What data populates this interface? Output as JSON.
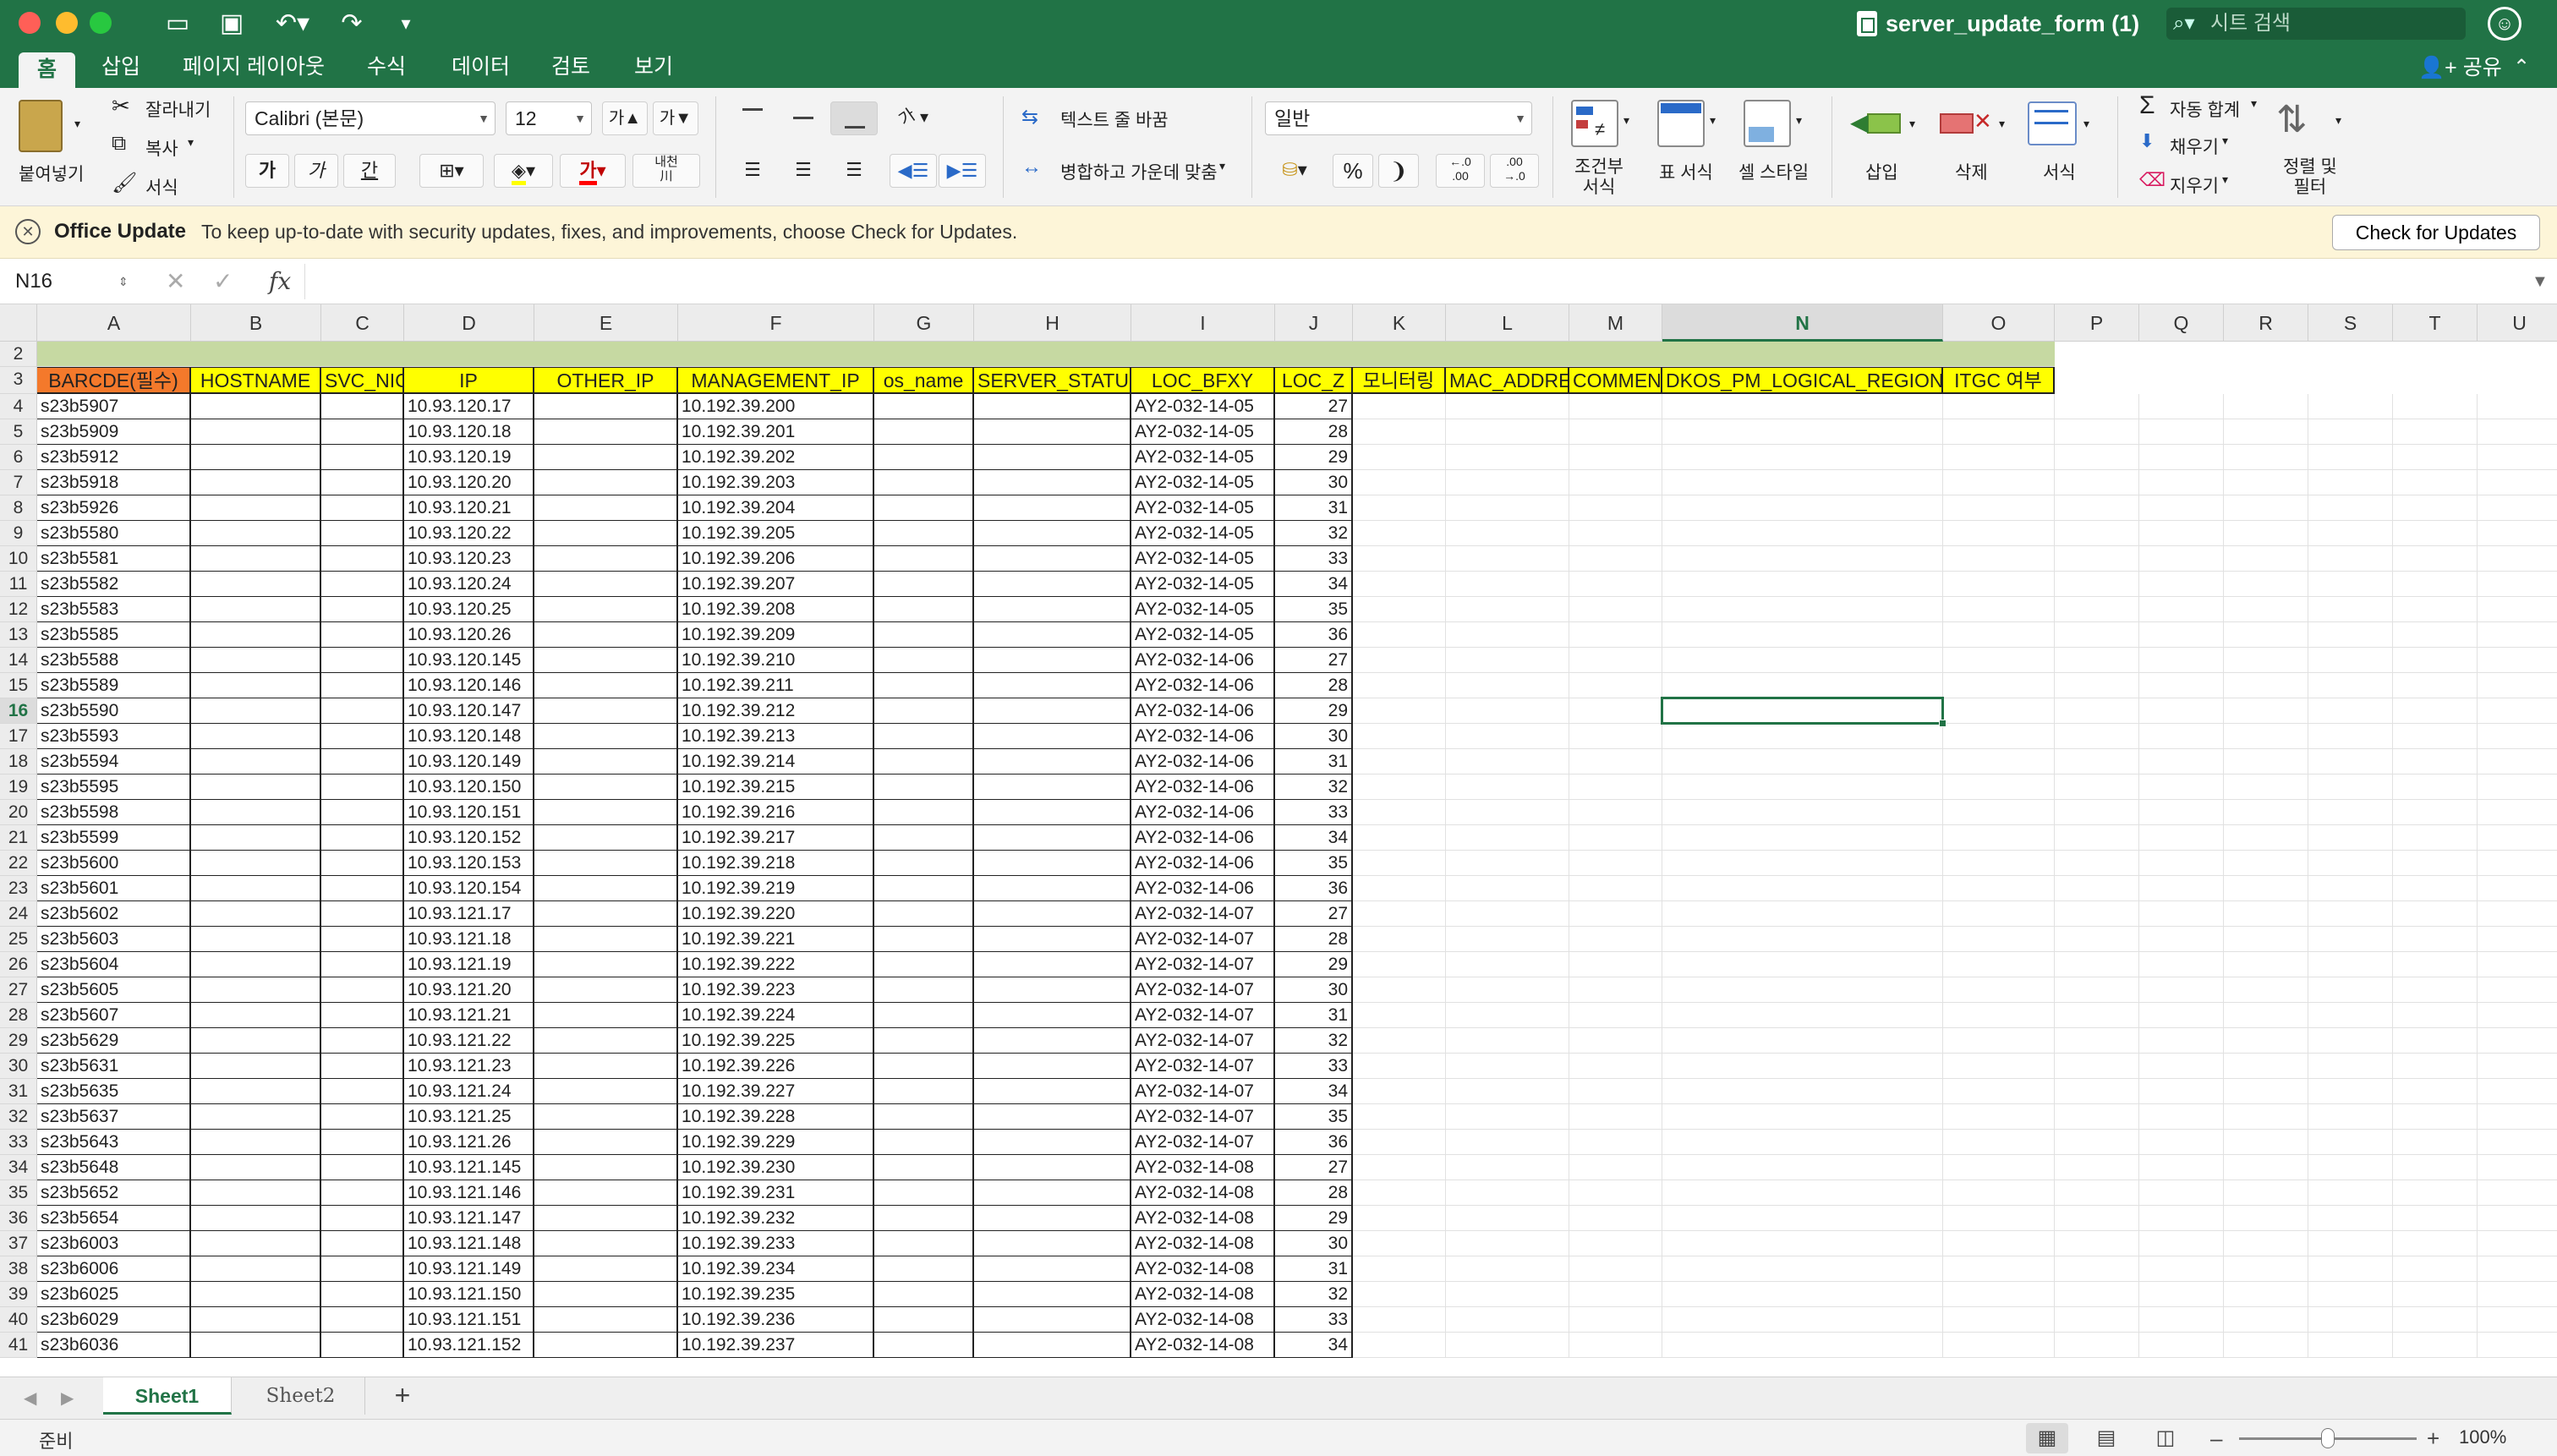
{
  "window": {
    "title": "server_update_form (1)"
  },
  "search": {
    "placeholder": "시트 검색",
    "icon": "search-icon"
  },
  "ribbon_tabs": [
    "홈",
    "삽입",
    "페이지 레이아웃",
    "수식",
    "데이터",
    "검토",
    "보기"
  ],
  "share_label": "공유",
  "ribbon": {
    "clipboard": {
      "paste": "붙여넣기",
      "cut": "잘라내기",
      "copy": "복사",
      "format_painter": "서식"
    },
    "font": {
      "name": "Calibri (본문)",
      "size": "12",
      "grow": "가▲",
      "shrink": "가▼",
      "bold": "가",
      "italic": "가",
      "underline": "간",
      "color_glyph": "가",
      "phonetic": "내천\n川"
    },
    "alignment": {
      "wrap_text": "텍스트 줄 바꿈",
      "merge_center": "병합하고 가운데 맞춤",
      "orientation": "가"
    },
    "number": {
      "format": "일반",
      "percent": "%",
      "comma": "❩",
      "inc_decimal": "←.0\n.00",
      "dec_decimal": ".00\n→.0"
    },
    "styles": {
      "conditional": "조건부\n서식",
      "table": "표 서식",
      "cell_style": "셀 스타일"
    },
    "cells": {
      "insert": "삽입",
      "delete": "삭제",
      "format": "서식"
    },
    "editing": {
      "autosum": "자동 합계",
      "fill": "채우기",
      "clear": "지우기",
      "sort_filter": "정렬 및\n필터"
    }
  },
  "update_bar": {
    "title": "Office Update",
    "message": "To keep up-to-date with security updates, fixes, and improvements, choose Check for Updates.",
    "button": "Check for Updates"
  },
  "formula_bar": {
    "name_box": "N16",
    "cancel": "✕",
    "enter": "✓",
    "fx": "fx",
    "value": ""
  },
  "grid": {
    "columns": [
      "A",
      "B",
      "C",
      "D",
      "E",
      "F",
      "G",
      "H",
      "I",
      "J",
      "K",
      "L",
      "M",
      "N",
      "O",
      "P",
      "Q",
      "R",
      "S",
      "T",
      "U"
    ],
    "selected_column": "N",
    "selected_cell": "N16",
    "header_row": [
      "BARCDE(필수)",
      "HOSTNAME",
      "SVC_NICK",
      "IP",
      "OTHER_IP",
      "MANAGEMENT_IP",
      "os_name",
      "SERVER_STATUS",
      "LOC_BFXY",
      "LOC_Z",
      "모니터링",
      "MAC_ADDRESS",
      "COMMENT",
      "DKOS_PM_LOGICAL_REGION",
      "ITGC 여부"
    ],
    "rows": [
      {
        "n": "4",
        "a": "s23b5907",
        "d": "10.93.120.17",
        "f": "10.192.39.200",
        "i": "AY2-032-14-05",
        "j": "27"
      },
      {
        "n": "5",
        "a": "s23b5909",
        "d": "10.93.120.18",
        "f": "10.192.39.201",
        "i": "AY2-032-14-05",
        "j": "28"
      },
      {
        "n": "6",
        "a": "s23b5912",
        "d": "10.93.120.19",
        "f": "10.192.39.202",
        "i": "AY2-032-14-05",
        "j": "29"
      },
      {
        "n": "7",
        "a": "s23b5918",
        "d": "10.93.120.20",
        "f": "10.192.39.203",
        "i": "AY2-032-14-05",
        "j": "30"
      },
      {
        "n": "8",
        "a": "s23b5926",
        "d": "10.93.120.21",
        "f": "10.192.39.204",
        "i": "AY2-032-14-05",
        "j": "31"
      },
      {
        "n": "9",
        "a": "s23b5580",
        "d": "10.93.120.22",
        "f": "10.192.39.205",
        "i": "AY2-032-14-05",
        "j": "32"
      },
      {
        "n": "10",
        "a": "s23b5581",
        "d": "10.93.120.23",
        "f": "10.192.39.206",
        "i": "AY2-032-14-05",
        "j": "33"
      },
      {
        "n": "11",
        "a": "s23b5582",
        "d": "10.93.120.24",
        "f": "10.192.39.207",
        "i": "AY2-032-14-05",
        "j": "34"
      },
      {
        "n": "12",
        "a": "s23b5583",
        "d": "10.93.120.25",
        "f": "10.192.39.208",
        "i": "AY2-032-14-05",
        "j": "35"
      },
      {
        "n": "13",
        "a": "s23b5585",
        "d": "10.93.120.26",
        "f": "10.192.39.209",
        "i": "AY2-032-14-05",
        "j": "36"
      },
      {
        "n": "14",
        "a": "s23b5588",
        "d": "10.93.120.145",
        "f": "10.192.39.210",
        "i": "AY2-032-14-06",
        "j": "27"
      },
      {
        "n": "15",
        "a": "s23b5589",
        "d": "10.93.120.146",
        "f": "10.192.39.211",
        "i": "AY2-032-14-06",
        "j": "28"
      },
      {
        "n": "16",
        "a": "s23b5590",
        "d": "10.93.120.147",
        "f": "10.192.39.212",
        "i": "AY2-032-14-06",
        "j": "29"
      },
      {
        "n": "17",
        "a": "s23b5593",
        "d": "10.93.120.148",
        "f": "10.192.39.213",
        "i": "AY2-032-14-06",
        "j": "30"
      },
      {
        "n": "18",
        "a": "s23b5594",
        "d": "10.93.120.149",
        "f": "10.192.39.214",
        "i": "AY2-032-14-06",
        "j": "31"
      },
      {
        "n": "19",
        "a": "s23b5595",
        "d": "10.93.120.150",
        "f": "10.192.39.215",
        "i": "AY2-032-14-06",
        "j": "32"
      },
      {
        "n": "20",
        "a": "s23b5598",
        "d": "10.93.120.151",
        "f": "10.192.39.216",
        "i": "AY2-032-14-06",
        "j": "33"
      },
      {
        "n": "21",
        "a": "s23b5599",
        "d": "10.93.120.152",
        "f": "10.192.39.217",
        "i": "AY2-032-14-06",
        "j": "34"
      },
      {
        "n": "22",
        "a": "s23b5600",
        "d": "10.93.120.153",
        "f": "10.192.39.218",
        "i": "AY2-032-14-06",
        "j": "35"
      },
      {
        "n": "23",
        "a": "s23b5601",
        "d": "10.93.120.154",
        "f": "10.192.39.219",
        "i": "AY2-032-14-06",
        "j": "36"
      },
      {
        "n": "24",
        "a": "s23b5602",
        "d": "10.93.121.17",
        "f": "10.192.39.220",
        "i": "AY2-032-14-07",
        "j": "27"
      },
      {
        "n": "25",
        "a": "s23b5603",
        "d": "10.93.121.18",
        "f": "10.192.39.221",
        "i": "AY2-032-14-07",
        "j": "28"
      },
      {
        "n": "26",
        "a": "s23b5604",
        "d": "10.93.121.19",
        "f": "10.192.39.222",
        "i": "AY2-032-14-07",
        "j": "29"
      },
      {
        "n": "27",
        "a": "s23b5605",
        "d": "10.93.121.20",
        "f": "10.192.39.223",
        "i": "AY2-032-14-07",
        "j": "30"
      },
      {
        "n": "28",
        "a": "s23b5607",
        "d": "10.93.121.21",
        "f": "10.192.39.224",
        "i": "AY2-032-14-07",
        "j": "31"
      },
      {
        "n": "29",
        "a": "s23b5629",
        "d": "10.93.121.22",
        "f": "10.192.39.225",
        "i": "AY2-032-14-07",
        "j": "32"
      },
      {
        "n": "30",
        "a": "s23b5631",
        "d": "10.93.121.23",
        "f": "10.192.39.226",
        "i": "AY2-032-14-07",
        "j": "33"
      },
      {
        "n": "31",
        "a": "s23b5635",
        "d": "10.93.121.24",
        "f": "10.192.39.227",
        "i": "AY2-032-14-07",
        "j": "34"
      },
      {
        "n": "32",
        "a": "s23b5637",
        "d": "10.93.121.25",
        "f": "10.192.39.228",
        "i": "AY2-032-14-07",
        "j": "35"
      },
      {
        "n": "33",
        "a": "s23b5643",
        "d": "10.93.121.26",
        "f": "10.192.39.229",
        "i": "AY2-032-14-07",
        "j": "36"
      },
      {
        "n": "34",
        "a": "s23b5648",
        "d": "10.93.121.145",
        "f": "10.192.39.230",
        "i": "AY2-032-14-08",
        "j": "27"
      },
      {
        "n": "35",
        "a": "s23b5652",
        "d": "10.93.121.146",
        "f": "10.192.39.231",
        "i": "AY2-032-14-08",
        "j": "28"
      },
      {
        "n": "36",
        "a": "s23b5654",
        "d": "10.93.121.147",
        "f": "10.192.39.232",
        "i": "AY2-032-14-08",
        "j": "29"
      },
      {
        "n": "37",
        "a": "s23b6003",
        "d": "10.93.121.148",
        "f": "10.192.39.233",
        "i": "AY2-032-14-08",
        "j": "30"
      },
      {
        "n": "38",
        "a": "s23b6006",
        "d": "10.93.121.149",
        "f": "10.192.39.234",
        "i": "AY2-032-14-08",
        "j": "31"
      },
      {
        "n": "39",
        "a": "s23b6025",
        "d": "10.93.121.150",
        "f": "10.192.39.235",
        "i": "AY2-032-14-08",
        "j": "32"
      },
      {
        "n": "40",
        "a": "s23b6029",
        "d": "10.93.121.151",
        "f": "10.192.39.236",
        "i": "AY2-032-14-08",
        "j": "33"
      },
      {
        "n": "41",
        "a": "s23b6036",
        "d": "10.93.121.152",
        "f": "10.192.39.237",
        "i": "AY2-032-14-08",
        "j": "34"
      }
    ]
  },
  "sheets": [
    {
      "name": "Sheet1",
      "active": true
    },
    {
      "name": "Sheet2",
      "active": false
    }
  ],
  "status": {
    "text": "준비",
    "zoom": "100%",
    "zoom_fraction": 0.5
  },
  "colors": {
    "brand": "#217346",
    "header_yellow": "#ffff00",
    "required_orange": "#f4792b",
    "title_green": "#c6d9a2",
    "update_bar": "#fdf5d8"
  }
}
